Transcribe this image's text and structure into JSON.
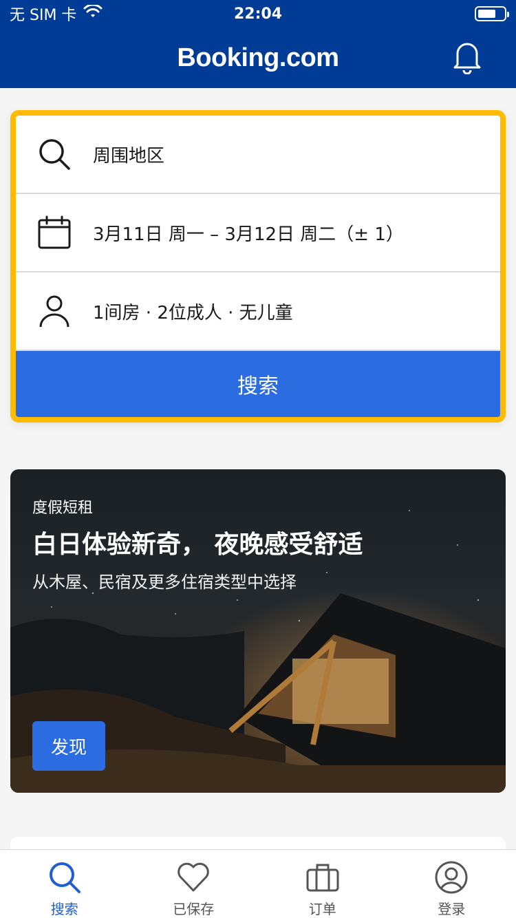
{
  "status_bar": {
    "carrier": "无 SIM 卡",
    "time": "22:04"
  },
  "header": {
    "brand": "Booking.com"
  },
  "search": {
    "destination": "周围地区",
    "dates": "3月11日 周一  –  3月12日 周二（± 1）",
    "guests": "1间房 · 2位成人 · 无儿童",
    "button_label": "搜索"
  },
  "promo": {
    "tag": "度假短租",
    "title": "白日体验新奇，  夜晚感受舒适",
    "subtitle": "从木屋、民宿及更多住宿类型中选择",
    "button_label": "发现"
  },
  "tabs": [
    {
      "label": "搜索",
      "icon": "search-icon",
      "active": true
    },
    {
      "label": "已保存",
      "icon": "heart-icon",
      "active": false
    },
    {
      "label": "订单",
      "icon": "briefcase-icon",
      "active": false
    },
    {
      "label": "登录",
      "icon": "user-circle-icon",
      "active": false
    }
  ],
  "colors": {
    "brand_blue": "#003b95",
    "accent_blue": "#2b6ce0",
    "highlight_yellow": "#febb02"
  }
}
